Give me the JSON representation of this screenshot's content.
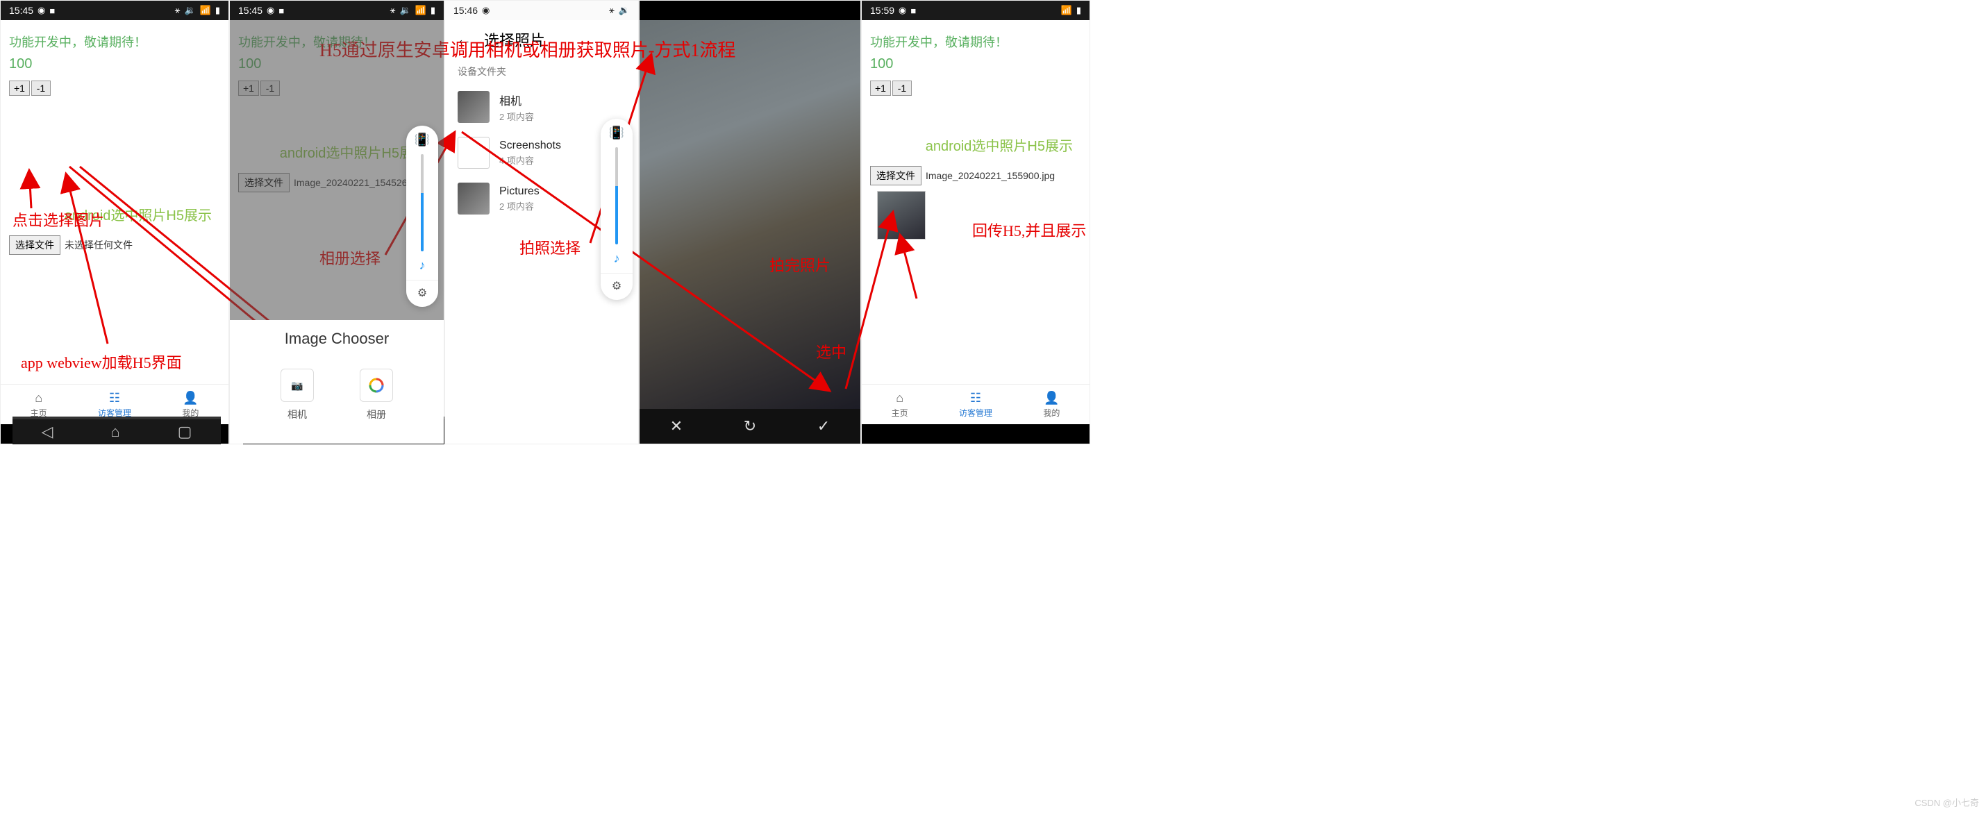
{
  "statusbar": {
    "time1": "15:45",
    "time2": "15:45",
    "time3": "15:46",
    "time4": "15:59",
    "icons": {
      "browser": "◉",
      "square": "■",
      "bt": "⚹",
      "vol": "🔉",
      "wifi": "▲",
      "sig": "▮",
      "wifi2": "📶"
    }
  },
  "app": {
    "develop_msg": "功能开发中，敬请期待！",
    "counter": "100",
    "plus": "+1",
    "minus": "-1",
    "h5_title": "android选中照片H5展示",
    "choose_btn": "选择文件",
    "no_file": "未选择任何文件",
    "file1": "Image_20240221_154526.jpg",
    "file2": "Image_20240221_155900.jpg"
  },
  "nav": {
    "home": "主页",
    "visitor": "访客管理",
    "mine": "我的"
  },
  "chooser": {
    "title": "Image Chooser",
    "camera": "相机",
    "album": "相册"
  },
  "picker": {
    "title": "选择照片",
    "device_folder": "设备文件夹",
    "f1": {
      "name": "相机",
      "count": "2 项内容"
    },
    "f2": {
      "name": "Screenshots",
      "count": "4 项内容"
    },
    "f3": {
      "name": "Pictures",
      "count": "2 项内容"
    }
  },
  "anno": {
    "main": "H5通过原生安卓调用相机或相册获取照片-方式1流程",
    "click_select": "点击选择图片",
    "webview": "app webview加载H5界面",
    "album_sel": "相册选择",
    "photo_sel": "拍照选择",
    "photo_done": "拍完照片",
    "selected": "选中",
    "callback": "回传H5,并且展示"
  },
  "wm": "CSDN @小七奇"
}
